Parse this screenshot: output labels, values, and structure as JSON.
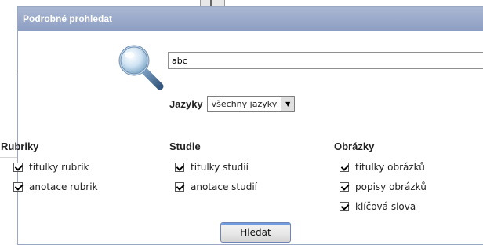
{
  "dialog": {
    "title": "Podrobné prohledat",
    "search": {
      "value": "abc",
      "placeholder": ""
    },
    "language": {
      "label": "Jazyky",
      "selected": "všechny jazyky"
    },
    "columns": [
      {
        "title": "Rubriky",
        "options": [
          {
            "label": "titulky rubrik",
            "checked": true
          },
          {
            "label": "anotace rubrik",
            "checked": true
          }
        ]
      },
      {
        "title": "Studie",
        "options": [
          {
            "label": "titulky studií",
            "checked": true
          },
          {
            "label": "anotace studií",
            "checked": true
          }
        ]
      },
      {
        "title": "Obrázky",
        "options": [
          {
            "label": "titulky obrázků",
            "checked": true
          },
          {
            "label": "popisy obrázků",
            "checked": true
          },
          {
            "label": "klíčová slova",
            "checked": true
          }
        ]
      }
    ],
    "submit_label": "Hledat"
  },
  "icons": {
    "search": "magnifier-icon",
    "dropdown": "chevron-down-icon",
    "checkbox": "checkmark-icon"
  },
  "colors": {
    "titlebar": "#8e9fc3",
    "border": "#9aa8c4",
    "button_accent": "#6f9de0"
  }
}
